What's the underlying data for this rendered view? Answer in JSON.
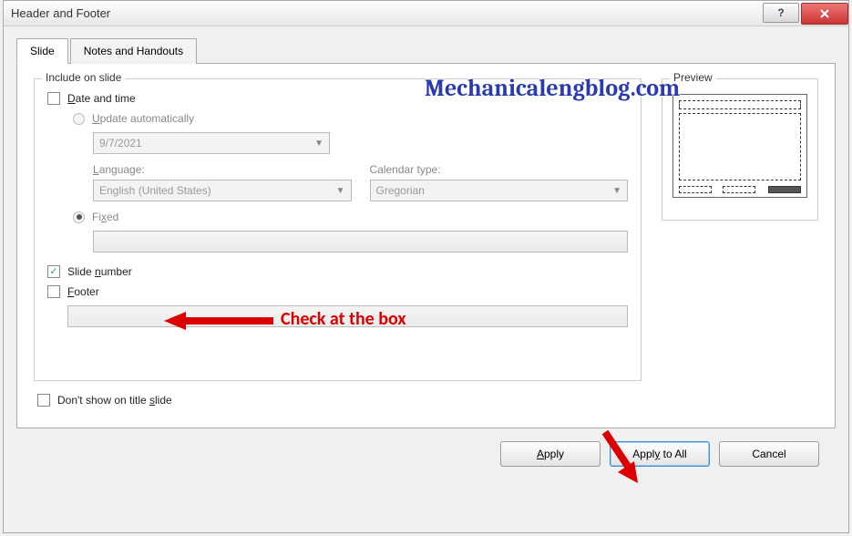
{
  "window": {
    "title": "Header and Footer"
  },
  "tabs": {
    "slide": "Slide",
    "notes": "Notes and Handouts"
  },
  "group": {
    "include_title": "Include on slide",
    "preview_title": "Preview"
  },
  "datetime": {
    "label_pre": "D",
    "label_rest": "ate and time",
    "update_pre": "U",
    "update_rest": "pdate automatically",
    "date_value": "9/7/2021",
    "language_label_pre": "L",
    "language_label_rest": "anguage:",
    "language_value": "English (United States)",
    "calendar_label": "Calendar type:",
    "calendar_value": "Gregorian",
    "fixed_pre": "Fi",
    "fixed_underline": "x",
    "fixed_rest": "ed"
  },
  "slide_number": {
    "pre": "Slide ",
    "underline": "n",
    "rest": "umber"
  },
  "footer": {
    "underline": "F",
    "rest": "ooter"
  },
  "dont_show": {
    "pre": "Don't show on title ",
    "underline": "s",
    "rest": "lide"
  },
  "buttons": {
    "apply_underline": "A",
    "apply_rest": "pply",
    "apply_all_pre": "Appl",
    "apply_all_underline": "y",
    "apply_all_rest": " to All",
    "cancel": "Cancel"
  },
  "annotations": {
    "watermark": "Mechanicalengblog.com",
    "check_text": "Check at the box"
  }
}
